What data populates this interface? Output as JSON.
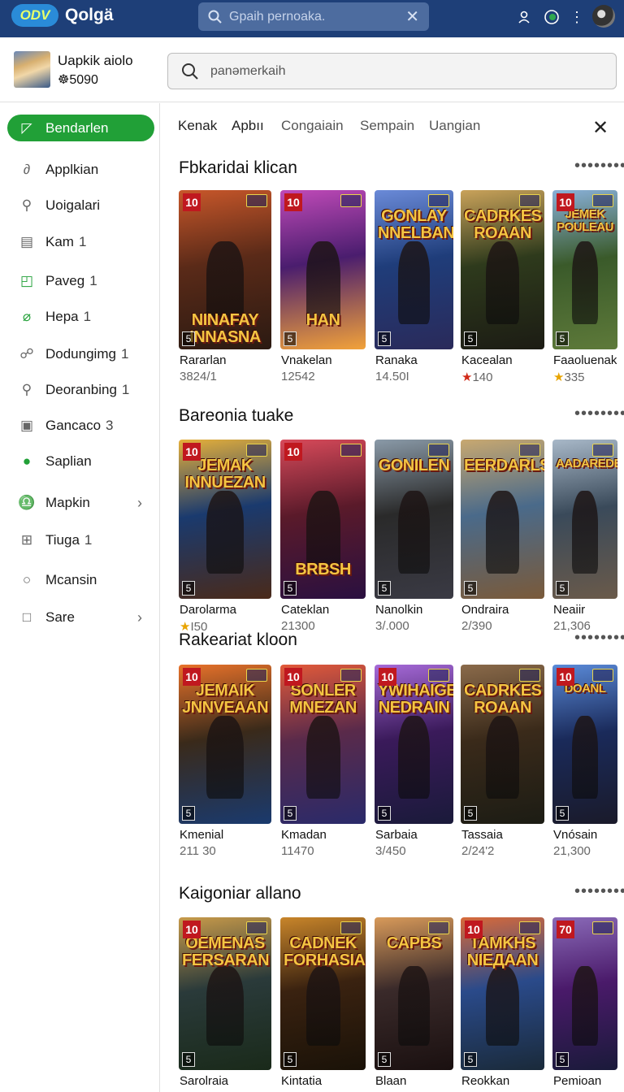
{
  "topbar": {
    "brand": "ODV",
    "title": "Qolgä",
    "search_placeholder": "Gpaih pernoaka.",
    "icons": [
      "search-icon",
      "clear-icon",
      "user-icon",
      "globe-icon",
      "more-vert-icon",
      "avatar"
    ]
  },
  "profile": {
    "name": "Uapkik aiolo",
    "coins": "☸5090",
    "search_placeholder": "panəmerkaih"
  },
  "sidebar": {
    "items": [
      {
        "label": "Bendarlen",
        "count": "",
        "icon": "home-icon",
        "glyph": "◸"
      },
      {
        "label": "Applkian",
        "count": "",
        "icon": "apps-icon",
        "glyph": "∂"
      },
      {
        "label": "Uoigalari",
        "count": "",
        "icon": "search-icon",
        "glyph": "⚲"
      },
      {
        "label": "Kam",
        "count": "1",
        "icon": "document-icon",
        "glyph": "▤"
      },
      {
        "label": "Paveg",
        "count": "1",
        "icon": "bag-icon",
        "glyph": "◰"
      },
      {
        "label": "Hepa",
        "count": "1",
        "icon": "leaf-icon",
        "glyph": "⌀"
      },
      {
        "label": "Dodungimg",
        "count": "1",
        "icon": "people-icon",
        "glyph": "☍"
      },
      {
        "label": "Deoranbing",
        "count": "1",
        "icon": "magnifier-icon",
        "glyph": "⚲"
      },
      {
        "label": "Gancaco",
        "count": "3",
        "icon": "calendar-icon",
        "glyph": "▣"
      },
      {
        "label": "Saplian",
        "count": "",
        "icon": "badge-icon",
        "glyph": "●"
      },
      {
        "label": "Mapkin",
        "count": "",
        "icon": "bell-icon",
        "glyph": "♎",
        "chevron": "›"
      },
      {
        "label": "Tiuga",
        "count": "1",
        "icon": "grid-icon",
        "glyph": "⊞"
      },
      {
        "label": "Mcansin",
        "count": "",
        "icon": "circle-icon",
        "glyph": "○"
      },
      {
        "label": "Sare",
        "count": "",
        "icon": "square-icon",
        "glyph": "□",
        "chevron": "›"
      }
    ]
  },
  "tabs": [
    "Kenak",
    "Apbıı",
    "Congaiain",
    "Sempain",
    "Uangian"
  ],
  "sections": [
    {
      "title": "Fbkaridai klican",
      "cards": [
        {
          "badge": "10",
          "logo": "Ninafay Innasna",
          "name": "Rararlan",
          "sub": "3824/1",
          "star": ""
        },
        {
          "badge": "10",
          "logo": "Han",
          "name": "Vnakelan",
          "sub": "12542",
          "star": ""
        },
        {
          "badge": "",
          "logo": "Gonlay Nnelban",
          "name": "Ranaka",
          "sub": "14.50I",
          "star": ""
        },
        {
          "badge": "",
          "logo": "Cadrkes Roaan",
          "name": "Kacealan",
          "sub": "140",
          "star": "red"
        },
        {
          "badge": "10",
          "logo": "Jemek Pouleau",
          "name": "Faaoluenak",
          "sub": "335",
          "star": "gold"
        }
      ]
    },
    {
      "title": "Bareonia tuake",
      "cards": [
        {
          "badge": "10",
          "logo": "Jemak Innuezan",
          "name": "Darolarma",
          "sub": "I50",
          "star": "gold"
        },
        {
          "badge": "10",
          "logo": "Brbsh",
          "name": "Cateklan",
          "sub": "21300",
          "star": ""
        },
        {
          "badge": "",
          "logo": "Gonilen",
          "name": "Nanolkin",
          "sub": "3/.000",
          "star": ""
        },
        {
          "badge": "",
          "logo": "Eerdarls",
          "name": "Ondraira",
          "sub": "2/390",
          "star": ""
        },
        {
          "badge": "",
          "logo": "Aadaredeea",
          "name": "Neaiir",
          "sub": "21,306",
          "star": ""
        }
      ]
    },
    {
      "title": "Rakeariat kloon",
      "cards": [
        {
          "badge": "10",
          "logo": "Jemaik Jnnveaan",
          "name": "Kmenial",
          "sub": "211 30",
          "star": ""
        },
        {
          "badge": "10",
          "logo": "Sonler Mnezan",
          "name": "Kmadan",
          "sub": "11470",
          "star": ""
        },
        {
          "badge": "10",
          "logo": "Ywihaige Nedrain",
          "name": "Sarbaia",
          "sub": "3/450",
          "star": ""
        },
        {
          "badge": "",
          "logo": "Cadrkes Roaan",
          "name": "Tassaia",
          "sub": "2/24'2",
          "star": ""
        },
        {
          "badge": "10",
          "logo": "Doanl",
          "name": "Vnósain",
          "sub": "21,300",
          "star": ""
        }
      ]
    },
    {
      "title": "Kaigoniar allano",
      "cards": [
        {
          "badge": "10",
          "logo": "Oemenas Fersaran",
          "name": "Sarolraia",
          "sub": "",
          "star": ""
        },
        {
          "badge": "",
          "logo": "Cadnek Forhasiaan",
          "name": "Kintatia",
          "sub": "",
          "star": ""
        },
        {
          "badge": "",
          "logo": "Capbs",
          "name": "Blaan",
          "sub": "",
          "star": ""
        },
        {
          "badge": "10",
          "logo": "Tamkhs Nieдaan",
          "name": "Reokkan",
          "sub": "",
          "star": ""
        },
        {
          "badge": "70",
          "logo": "",
          "name": "Pemioan",
          "sub": "",
          "star": ""
        }
      ]
    }
  ],
  "colors": {
    "topbar": "#1e3f78",
    "active_nav": "#21a037",
    "badge_red": "#c0181f",
    "logo_gold": "#f4c542"
  },
  "more_glyph": "••••••••",
  "close_glyph": "✕"
}
